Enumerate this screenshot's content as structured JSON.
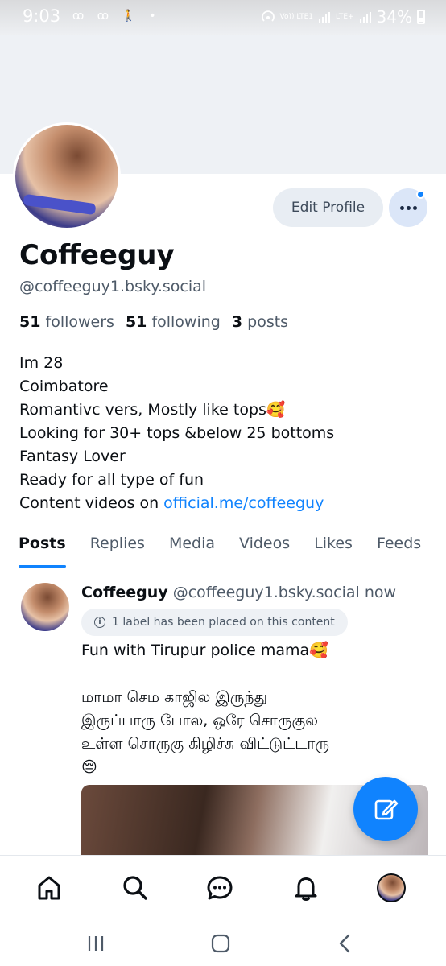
{
  "status_bar": {
    "time": "9:03",
    "left_icons": "ꝏ ꝏ 🚶 •",
    "network_1": "Vo)) LTE1",
    "network_2": "Vo)) LTE2",
    "network_2_tag": "LTE+",
    "battery": "34%"
  },
  "profile": {
    "display_name": "Coffeeguy",
    "handle": "@coffeeguy1.bsky.social",
    "edit_label": "Edit Profile",
    "more_icon": "more-horizontal-icon",
    "followers_count": "51",
    "followers_label": "followers",
    "following_count": "51",
    "following_label": "following",
    "posts_count": "3",
    "posts_label": "posts",
    "bio_lines": [
      "Im 28",
      "Coimbatore",
      "Romantivc vers, Mostly like tops🥰",
      "Looking for 30+ tops &below 25 bottoms",
      "Fantasy Lover",
      "Ready for all type of fun"
    ],
    "bio_link_prefix": "Content videos on ",
    "bio_link": "official.me/coffeeguy"
  },
  "tabs": [
    "Posts",
    "Replies",
    "Media",
    "Videos",
    "Likes",
    "Feeds"
  ],
  "post": {
    "author": "Coffeeguy",
    "handle": "@coffeeguy1.bsky.social",
    "time": "now",
    "label_notice": "1 label has been placed on this content",
    "text_line_1": "Fun with Tirupur police mama🥰",
    "text_tamil": [
      "மாமா செம காஜில இருந்து",
      "இருப்பாரு போல, ஒரே சொருகுல",
      "உள்ள சொருகு கிழிச்சு விட்டுட்டாரு",
      "😔"
    ]
  },
  "bottom_nav": {
    "items": [
      "home-icon",
      "search-icon",
      "chat-icon",
      "bell-icon",
      "profile-avatar"
    ]
  },
  "colors": {
    "accent": "#1083fe",
    "text": "#0b0f14",
    "muted": "#4e5a68",
    "banner": "#eef1f5"
  }
}
